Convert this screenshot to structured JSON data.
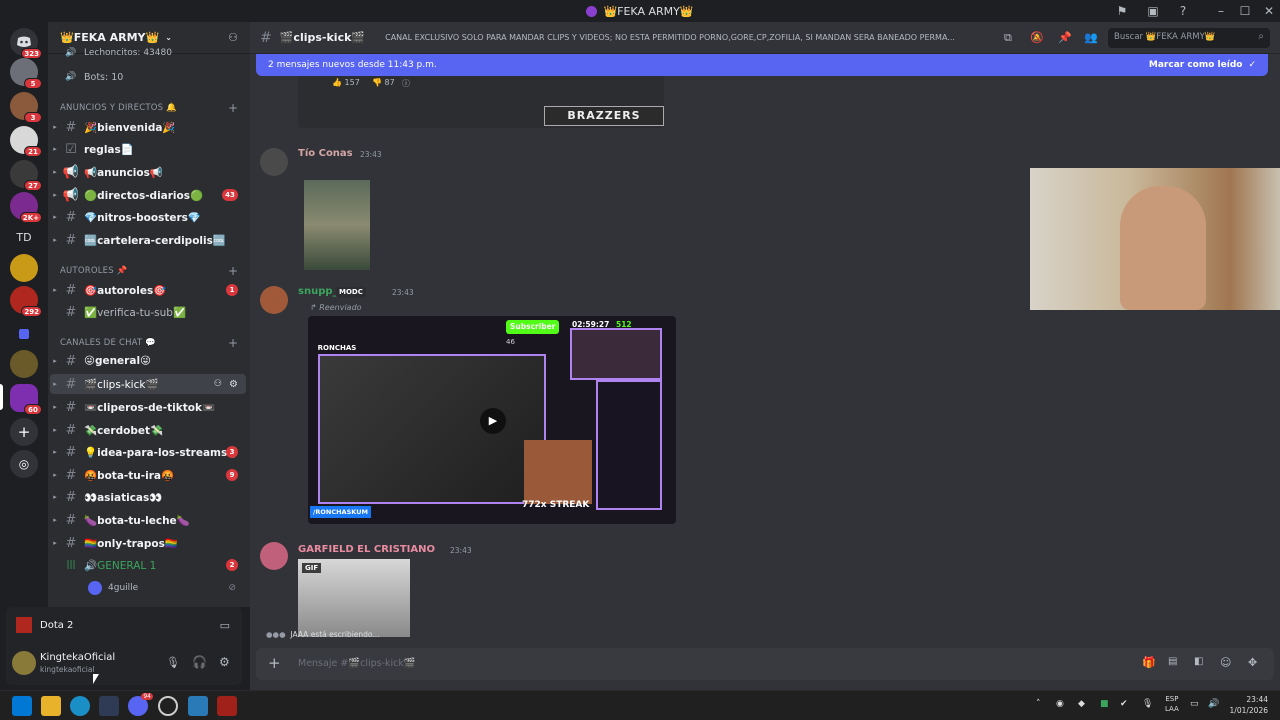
{
  "window": {
    "title": "👑FEKA ARMY👑"
  },
  "rail": {
    "badges": [
      "323",
      "5",
      "3",
      "21",
      "27",
      "2K+",
      "292",
      "60"
    ],
    "td_label": "TD"
  },
  "server": {
    "name": "👑FEKA ARMY👑"
  },
  "sidebar": {
    "top_items": [
      "Lechoncitos: 43480",
      "Bots: 10"
    ],
    "categories": [
      "ANUNCIOS Y DIRECTOS 🔔",
      "AUTOROLES 📌",
      "CANALES DE CHAT 💬"
    ],
    "channels": [
      {
        "name": "🎉bienvenida🎉",
        "count": ""
      },
      {
        "name": "reglas📄",
        "count": ""
      },
      {
        "name": "📢anuncios📢",
        "count": ""
      },
      {
        "name": "🟢directos-diarios🟢",
        "count": "43"
      },
      {
        "name": "💎nitros-boosters💎",
        "count": ""
      },
      {
        "name": "🆒cartelera-cerdipolis🆒",
        "count": ""
      },
      {
        "name": "🎯autoroles🎯",
        "count": "1"
      },
      {
        "name": "✅verifica-tu-sub✅",
        "count": ""
      },
      {
        "name": "😜general😜",
        "count": ""
      },
      {
        "name": "🎬clips-kick🎬",
        "count": ""
      },
      {
        "name": "📼cliperos-de-tiktok📼",
        "count": ""
      },
      {
        "name": "💸cerdobet💸",
        "count": ""
      },
      {
        "name": "💡idea-para-los-streams💡",
        "count": "3"
      },
      {
        "name": "🤬bota-tu-ira🤬",
        "count": "9"
      },
      {
        "name": "👀asiaticas👀",
        "count": ""
      },
      {
        "name": "🍆bota-tu-leche🍆",
        "count": ""
      },
      {
        "name": "🏳️‍🌈only-trapos🏳️‍🌈",
        "count": ""
      }
    ],
    "voice": {
      "name": "🔊GENERAL 1",
      "count": "2",
      "member": "4guille"
    }
  },
  "voicepanel": {
    "activity": "Dota 2"
  },
  "user": {
    "display": "KingtekaOficial",
    "handle": "kingtekaoficial"
  },
  "channel": {
    "name": "🎬clips-kick🎬",
    "topic": "CANAL EXCLUSIVO SOLO PARA MANDAR CLIPS Y VIDEOS; NO ESTA PERMITIDO PORNO,GORE,CP,ZOFILIA, SI MANDAN SERA BANEADO PERMA...",
    "search_placeholder": "Buscar 👑FEKA ARMY👑"
  },
  "newbar": {
    "text": "2 mensajes nuevos desde 11:43 p.m.",
    "action": "Marcar como leído"
  },
  "messages": {
    "reactions": [
      "157",
      "87"
    ],
    "brazzers": "BRAZZERS",
    "m1": {
      "author": "Tío Conas",
      "time": "23:43"
    },
    "m2": {
      "author": "snupp_",
      "tag": "MODC",
      "time": "23:43",
      "forwarded": "Reenviado",
      "video": {
        "sub": "Subscriber",
        "subcount": "46",
        "timer": "02:59:27",
        "viewers": "512",
        "streak": "772x STREAK",
        "fb": "/RONCHASKUM",
        "logo": "RONCHAS"
      }
    },
    "m3": {
      "author": "GARFIELD EL CRISTIANO",
      "time": "23:43",
      "gif": "GIF"
    },
    "typing": "JAAA está escribiendo..."
  },
  "composer": {
    "placeholder": "Mensaje #🎬clips-kick🎬"
  },
  "taskbar": {
    "lang1": "ESP",
    "lang2": "LAA",
    "time": "23:44",
    "date": "1/01/2026",
    "discord_badge": "94"
  },
  "colors": {
    "blurple": "#5865f2",
    "red": "#da373c",
    "green": "#3ba55d",
    "bg": "#313338"
  }
}
